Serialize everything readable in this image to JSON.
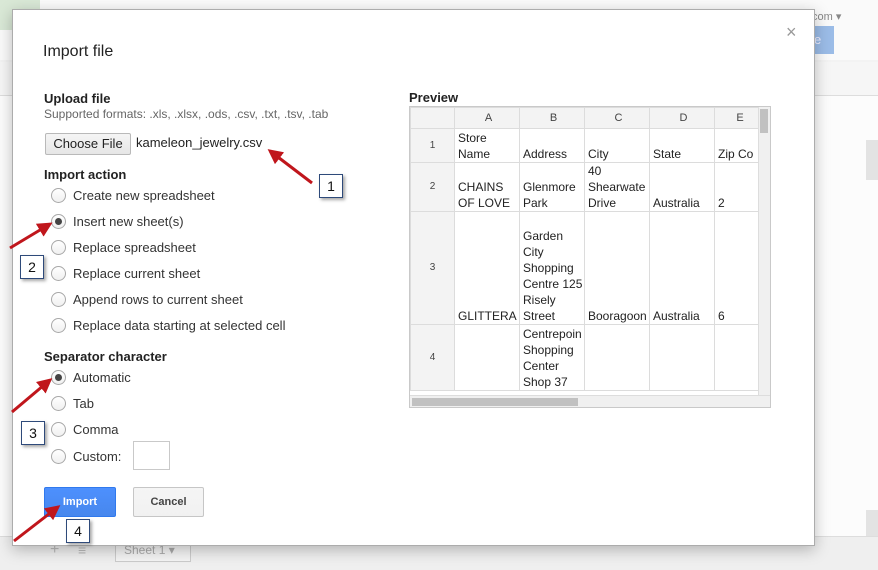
{
  "background": {
    "account_fragment": "com ▾",
    "share_fragment": "e",
    "sheet_tab_label": "Sheet 1 ▾"
  },
  "dialog": {
    "title": "Import file",
    "close_glyph": "×"
  },
  "upload": {
    "heading": "Upload file",
    "formats": "Supported formats: .xls, .xlsx, .ods, .csv, .txt, .tsv, .tab",
    "choose_label": "Choose File",
    "file_name": "kameleon_jewelry.csv"
  },
  "import_action": {
    "heading": "Import action",
    "options": [
      {
        "label": "Create new spreadsheet",
        "checked": false
      },
      {
        "label": "Insert new sheet(s)",
        "checked": true
      },
      {
        "label": "Replace spreadsheet",
        "checked": false
      },
      {
        "label": "Replace current sheet",
        "checked": false
      },
      {
        "label": "Append rows to current sheet",
        "checked": false
      },
      {
        "label": "Replace data starting at selected cell",
        "checked": false
      }
    ]
  },
  "separator": {
    "heading": "Separator character",
    "options": [
      {
        "label": "Automatic",
        "checked": true
      },
      {
        "label": "Tab",
        "checked": false
      },
      {
        "label": "Comma",
        "checked": false
      },
      {
        "label": "Custom:",
        "checked": false
      }
    ],
    "custom_value": ""
  },
  "buttons": {
    "import": "Import",
    "cancel": "Cancel"
  },
  "preview": {
    "heading": "Preview",
    "columns": [
      "A",
      "B",
      "C",
      "D",
      "E"
    ],
    "rows": [
      {
        "num": "1",
        "cells": [
          "Store Name",
          "Address",
          "City",
          "State",
          "Zip Co"
        ]
      },
      {
        "num": "2",
        "cells": [
          "CHAINS OF LOVE",
          "Glenmore Park",
          "40 Shearwate Drive",
          "Australia",
          "2"
        ]
      },
      {
        "num": "3",
        "cells": [
          "GLITTERA",
          "Garden City Shopping Centre 125 Risely Street",
          "Booragoon",
          "Australia",
          "6"
        ]
      },
      {
        "num": "4",
        "cells": [
          "",
          "Centrepoin Shopping Center Shop 37",
          "",
          "",
          ""
        ]
      }
    ]
  },
  "callouts": [
    "1",
    "2",
    "3",
    "4"
  ],
  "colors": {
    "import_button": "#4d90fe",
    "arrow": "#c0161c",
    "dialog_bg": "#ffffff"
  }
}
